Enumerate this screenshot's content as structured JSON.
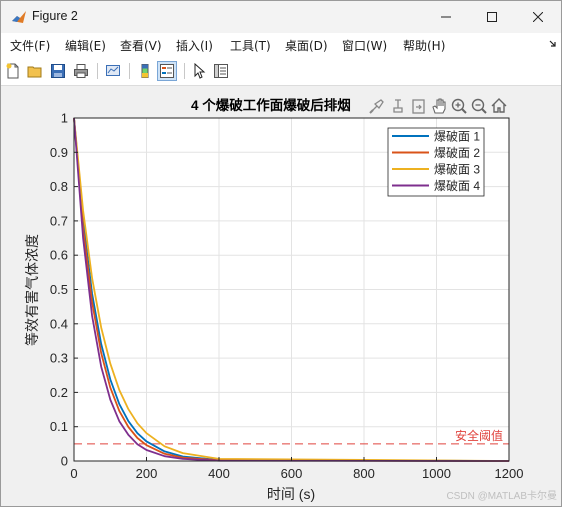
{
  "window": {
    "title": "Figure 2",
    "controls": [
      "minimize",
      "maximize",
      "close"
    ]
  },
  "menu": [
    {
      "label": "文件(F)"
    },
    {
      "label": "编辑(E)"
    },
    {
      "label": "查看(V)"
    },
    {
      "label": "插入(I)"
    },
    {
      "label": "工具(T)"
    },
    {
      "label": "桌面(D)"
    },
    {
      "label": "窗口(W)"
    },
    {
      "label": "帮助(H)"
    }
  ],
  "toolbar": {
    "buttons": [
      "new-figure-icon",
      "open-file-icon",
      "save-icon",
      "print-icon",
      "link-plot-icon",
      "colorbar-icon",
      "legend-icon",
      "pointer-icon",
      "property-editor-icon"
    ]
  },
  "axes_toolbar": [
    "brush-icon",
    "data-tip-icon",
    "export-icon",
    "pan-icon",
    "zoom-in-icon",
    "zoom-out-icon",
    "home-icon"
  ],
  "chart_data": {
    "type": "line",
    "title": "4 个爆破工作面爆破后排烟",
    "xlabel": "时间 (s)",
    "ylabel": "等效有害气体浓度",
    "xlim": [
      0,
      1200
    ],
    "ylim": [
      0,
      1
    ],
    "xticks": [
      "0",
      "200",
      "400",
      "600",
      "800",
      "1000",
      "1200"
    ],
    "yticks": [
      "0",
      "0.1",
      "0.2",
      "0.3",
      "0.4",
      "0.5",
      "0.6",
      "0.7",
      "0.8",
      "0.9",
      "1"
    ],
    "grid": true,
    "legend_position": "top-right",
    "series": [
      {
        "name": "爆破面 1",
        "color": "#0072bd",
        "x": [
          0,
          25,
          50,
          75,
          100,
          125,
          150,
          175,
          200,
          250,
          300,
          400,
          1200
        ],
        "values": [
          1,
          0.7,
          0.488,
          0.341,
          0.238,
          0.166,
          0.116,
          0.081,
          0.057,
          0.028,
          0.013,
          0.003,
          0
        ]
      },
      {
        "name": "爆破面 2",
        "color": "#d95319",
        "x": [
          0,
          25,
          50,
          75,
          100,
          125,
          150,
          175,
          200,
          250,
          300,
          400,
          1200
        ],
        "values": [
          1,
          0.68,
          0.463,
          0.315,
          0.214,
          0.146,
          0.099,
          0.067,
          0.046,
          0.021,
          0.01,
          0.002,
          0
        ]
      },
      {
        "name": "爆破面 3",
        "color": "#edb120",
        "x": [
          0,
          25,
          50,
          75,
          100,
          125,
          150,
          175,
          200,
          250,
          300,
          400,
          1200
        ],
        "values": [
          1,
          0.73,
          0.533,
          0.389,
          0.284,
          0.207,
          0.151,
          0.11,
          0.081,
          0.043,
          0.023,
          0.006,
          0
        ]
      },
      {
        "name": "爆破面 4",
        "color": "#7e2f8e",
        "x": [
          0,
          25,
          50,
          75,
          100,
          125,
          150,
          175,
          200,
          250,
          300,
          400,
          1200
        ],
        "values": [
          1,
          0.65,
          0.423,
          0.275,
          0.179,
          0.116,
          0.076,
          0.049,
          0.032,
          0.014,
          0.006,
          0.001,
          0
        ]
      }
    ],
    "threshold": {
      "label": "安全阈值",
      "value": 0.05,
      "color": "#e0443e"
    }
  },
  "watermark": "CSDN @MATLAB卡尔曼"
}
